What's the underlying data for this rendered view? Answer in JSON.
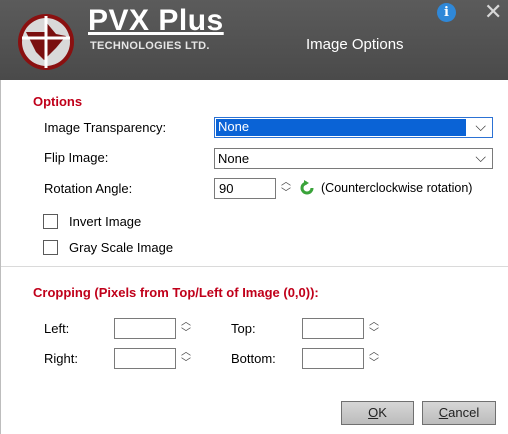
{
  "titlebar": {
    "brand": "PVX Plus",
    "brand_sub": "TECHNOLOGIES LTD.",
    "title": "Image Options",
    "info_glyph": "i",
    "close_glyph": "✕"
  },
  "options": {
    "section_title": "Options",
    "transparency_label": "Image Transparency:",
    "transparency_value": "None",
    "flip_label": "Flip Image:",
    "flip_value": "None",
    "rotation_label": "Rotation Angle:",
    "rotation_value": "90",
    "rotation_note": "(Counterclockwise rotation)",
    "invert_label": "Invert Image",
    "grayscale_label": "Gray Scale Image"
  },
  "cropping": {
    "section_title": "Cropping (Pixels from Top/Left of Image (0,0)):",
    "left_label": "Left:",
    "top_label": "Top:",
    "right_label": "Right:",
    "bottom_label": "Bottom:",
    "left_value": "",
    "top_value": "",
    "right_value": "",
    "bottom_value": ""
  },
  "buttons": {
    "ok_accel": "O",
    "ok_rest": "K",
    "cancel_accel": "C",
    "cancel_rest": "ancel"
  },
  "colors": {
    "titlebar": "#4f4f4f",
    "accent_red": "#c0001a",
    "selection_blue": "#0a63d6",
    "info_blue": "#2f88d8"
  }
}
